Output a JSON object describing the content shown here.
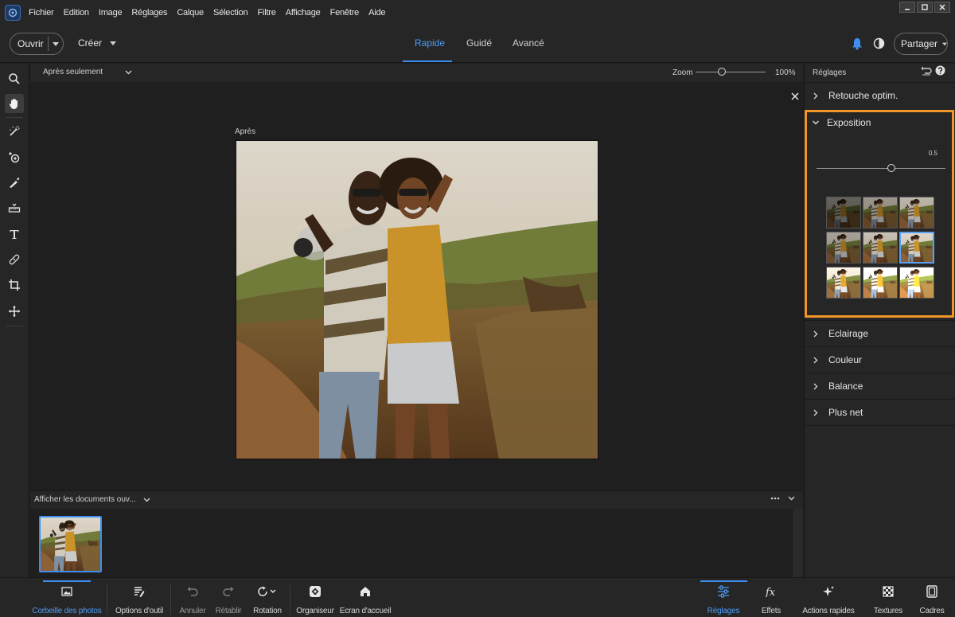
{
  "menu": [
    "Fichier",
    "Edition",
    "Image",
    "Réglages",
    "Calque",
    "Sélection",
    "Filtre",
    "Affichage",
    "Fenêtre",
    "Aide"
  ],
  "toolbar": {
    "open_label": "Ouvrir",
    "create_label": "Créer",
    "modes": [
      {
        "label": "Rapide",
        "active": true
      },
      {
        "label": "Guidé",
        "active": false
      },
      {
        "label": "Avancé",
        "active": false
      }
    ],
    "share_label": "Partager"
  },
  "tools": [
    "zoom-tool-icon",
    "hand-tool-icon",
    "quick-selection-icon",
    "red-eye-icon",
    "whiten-teeth-icon",
    "straighten-icon",
    "type-tool-icon",
    "spot-healing-icon",
    "crop-icon",
    "move-icon"
  ],
  "canvas": {
    "view_mode": "Après seulement",
    "zoom_label": "Zoom",
    "zoom_value": "100%",
    "zoom_fraction": 0.38,
    "after_label": "Après"
  },
  "documents": {
    "header": "Afficher les documents ouv..."
  },
  "panel": {
    "title": "Réglages",
    "sections": [
      {
        "label": "Retouche optim.",
        "expanded": false
      },
      {
        "label": "Exposition",
        "expanded": true
      },
      {
        "label": "Eclairage",
        "expanded": false
      },
      {
        "label": "Couleur",
        "expanded": false
      },
      {
        "label": "Balance",
        "expanded": false
      },
      {
        "label": "Plus net",
        "expanded": false
      }
    ],
    "exposure_value": "0.5",
    "exposure_fraction": 0.58,
    "preset_brightness": [
      0.45,
      0.7,
      0.85,
      0.75,
      0.9,
      1.0,
      1.15,
      1.35,
      1.6
    ],
    "selected_preset": 5
  },
  "bottom": {
    "left": [
      {
        "label": "Corbeille des photos",
        "icon": "photo-bin-icon",
        "active": true
      },
      {
        "label": "Options d'outil",
        "icon": "tool-options-icon"
      },
      {
        "label": "Annuler",
        "icon": "undo-icon",
        "disabled": true
      },
      {
        "label": "Rétablir",
        "icon": "redo-icon",
        "disabled": true
      },
      {
        "label": "Rotation",
        "icon": "rotate-icon"
      },
      {
        "label": "Organiseur",
        "icon": "organizer-icon"
      },
      {
        "label": "Ecran d'accueil",
        "icon": "home-icon"
      }
    ],
    "right": [
      {
        "label": "Réglages",
        "icon": "adjustments-icon",
        "active": true
      },
      {
        "label": "Effets",
        "icon": "effects-icon"
      },
      {
        "label": "Actions rapides",
        "icon": "quick-actions-icon"
      },
      {
        "label": "Textures",
        "icon": "textures-icon"
      },
      {
        "label": "Cadres",
        "icon": "frames-icon"
      }
    ]
  },
  "colors": {
    "accent": "#3d8ef0",
    "highlight_box": "#f3962a",
    "background": "#1f1f1f",
    "panel": "#262626"
  }
}
